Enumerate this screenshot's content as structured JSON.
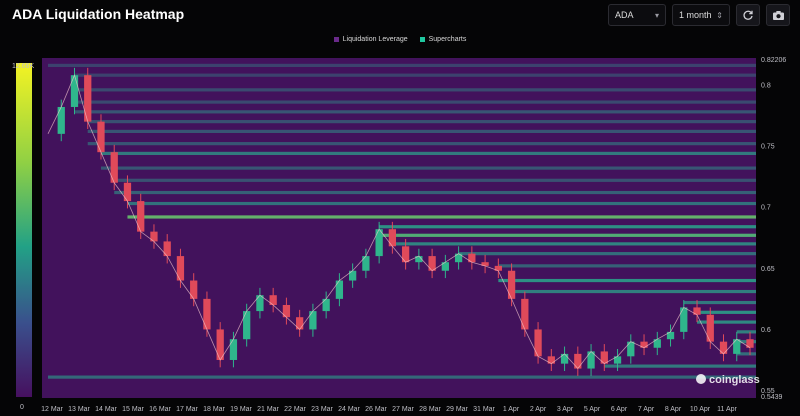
{
  "header": {
    "title": "ADA Liquidation Heatmap",
    "coin_select": "ADA",
    "range_select": "1 month"
  },
  "icons": {
    "refresh": "refresh-icon",
    "camera": "camera-icon",
    "caret": "chevron-updown-icon"
  },
  "colors": {
    "low": "#46105f",
    "mid": "#2aa48a",
    "high": "#f2ee24",
    "candle_up": "#2fb68c",
    "candle_down": "#e04a5a"
  },
  "chart_data": {
    "type": "heatmap",
    "title": "ADA Liquidation Heatmap",
    "legend": [
      "Liquidation Leverage",
      "Supercharts"
    ],
    "legend_colors": [
      "#6a2a8a",
      "#1fc8a0"
    ],
    "colorbar": {
      "min": "0",
      "max": "12.66K"
    },
    "x_ticks": [
      "12 Mar",
      "13 Mar",
      "14 Mar",
      "15 Mar",
      "16 Mar",
      "17 Mar",
      "18 Mar",
      "19 Mar",
      "21 Mar",
      "22 Mar",
      "23 Mar",
      "24 Mar",
      "26 Mar",
      "27 Mar",
      "28 Mar",
      "29 Mar",
      "31 Mar",
      "1 Apr",
      "2 Apr",
      "3 Apr",
      "5 Apr",
      "6 Apr",
      "7 Apr",
      "8 Apr",
      "10 Apr",
      "11 Apr"
    ],
    "y_ticks": [
      "0.82206",
      "0.8",
      "0.75",
      "0.7",
      "0.65",
      "0.6",
      "0.55",
      "0.5439"
    ],
    "y_tick_values": [
      0.82206,
      0.8,
      0.75,
      0.7,
      0.65,
      0.6,
      0.55,
      0.5439
    ],
    "ylim": [
      0.5439,
      0.82206
    ],
    "price_series": [
      0.76,
      0.782,
      0.808,
      0.77,
      0.745,
      0.72,
      0.705,
      0.68,
      0.672,
      0.66,
      0.64,
      0.625,
      0.6,
      0.575,
      0.592,
      0.615,
      0.628,
      0.62,
      0.61,
      0.6,
      0.615,
      0.625,
      0.64,
      0.648,
      0.66,
      0.682,
      0.668,
      0.655,
      0.66,
      0.648,
      0.655,
      0.662,
      0.655,
      0.652,
      0.648,
      0.625,
      0.6,
      0.578,
      0.572,
      0.58,
      0.568,
      0.582,
      0.572,
      0.578,
      0.59,
      0.585,
      0.592,
      0.598,
      0.618,
      0.612,
      0.59,
      0.58,
      0.592,
      0.585
    ],
    "bands": [
      {
        "price": 0.816,
        "intensity": 0.22
      },
      {
        "price": 0.808,
        "intensity": 0.22
      },
      {
        "price": 0.796,
        "intensity": 0.25
      },
      {
        "price": 0.786,
        "intensity": 0.25
      },
      {
        "price": 0.778,
        "intensity": 0.3
      },
      {
        "price": 0.77,
        "intensity": 0.28
      },
      {
        "price": 0.762,
        "intensity": 0.3
      },
      {
        "price": 0.752,
        "intensity": 0.3
      },
      {
        "price": 0.744,
        "intensity": 0.45
      },
      {
        "price": 0.732,
        "intensity": 0.3
      },
      {
        "price": 0.722,
        "intensity": 0.28
      },
      {
        "price": 0.712,
        "intensity": 0.35
      },
      {
        "price": 0.703,
        "intensity": 0.42
      },
      {
        "price": 0.692,
        "intensity": 0.72
      },
      {
        "price": 0.684,
        "intensity": 0.55
      },
      {
        "price": 0.677,
        "intensity": 0.68
      },
      {
        "price": 0.67,
        "intensity": 0.5
      },
      {
        "price": 0.662,
        "intensity": 0.4
      },
      {
        "price": 0.652,
        "intensity": 0.35
      },
      {
        "price": 0.64,
        "intensity": 0.55
      },
      {
        "price": 0.631,
        "intensity": 0.48
      },
      {
        "price": 0.622,
        "intensity": 0.45
      },
      {
        "price": 0.614,
        "intensity": 0.55
      },
      {
        "price": 0.606,
        "intensity": 0.52
      },
      {
        "price": 0.598,
        "intensity": 0.48
      },
      {
        "price": 0.59,
        "intensity": 0.45
      },
      {
        "price": 0.58,
        "intensity": 0.4
      },
      {
        "price": 0.57,
        "intensity": 0.45
      },
      {
        "price": 0.561,
        "intensity": 0.38
      }
    ],
    "watermark": "coinglass"
  }
}
